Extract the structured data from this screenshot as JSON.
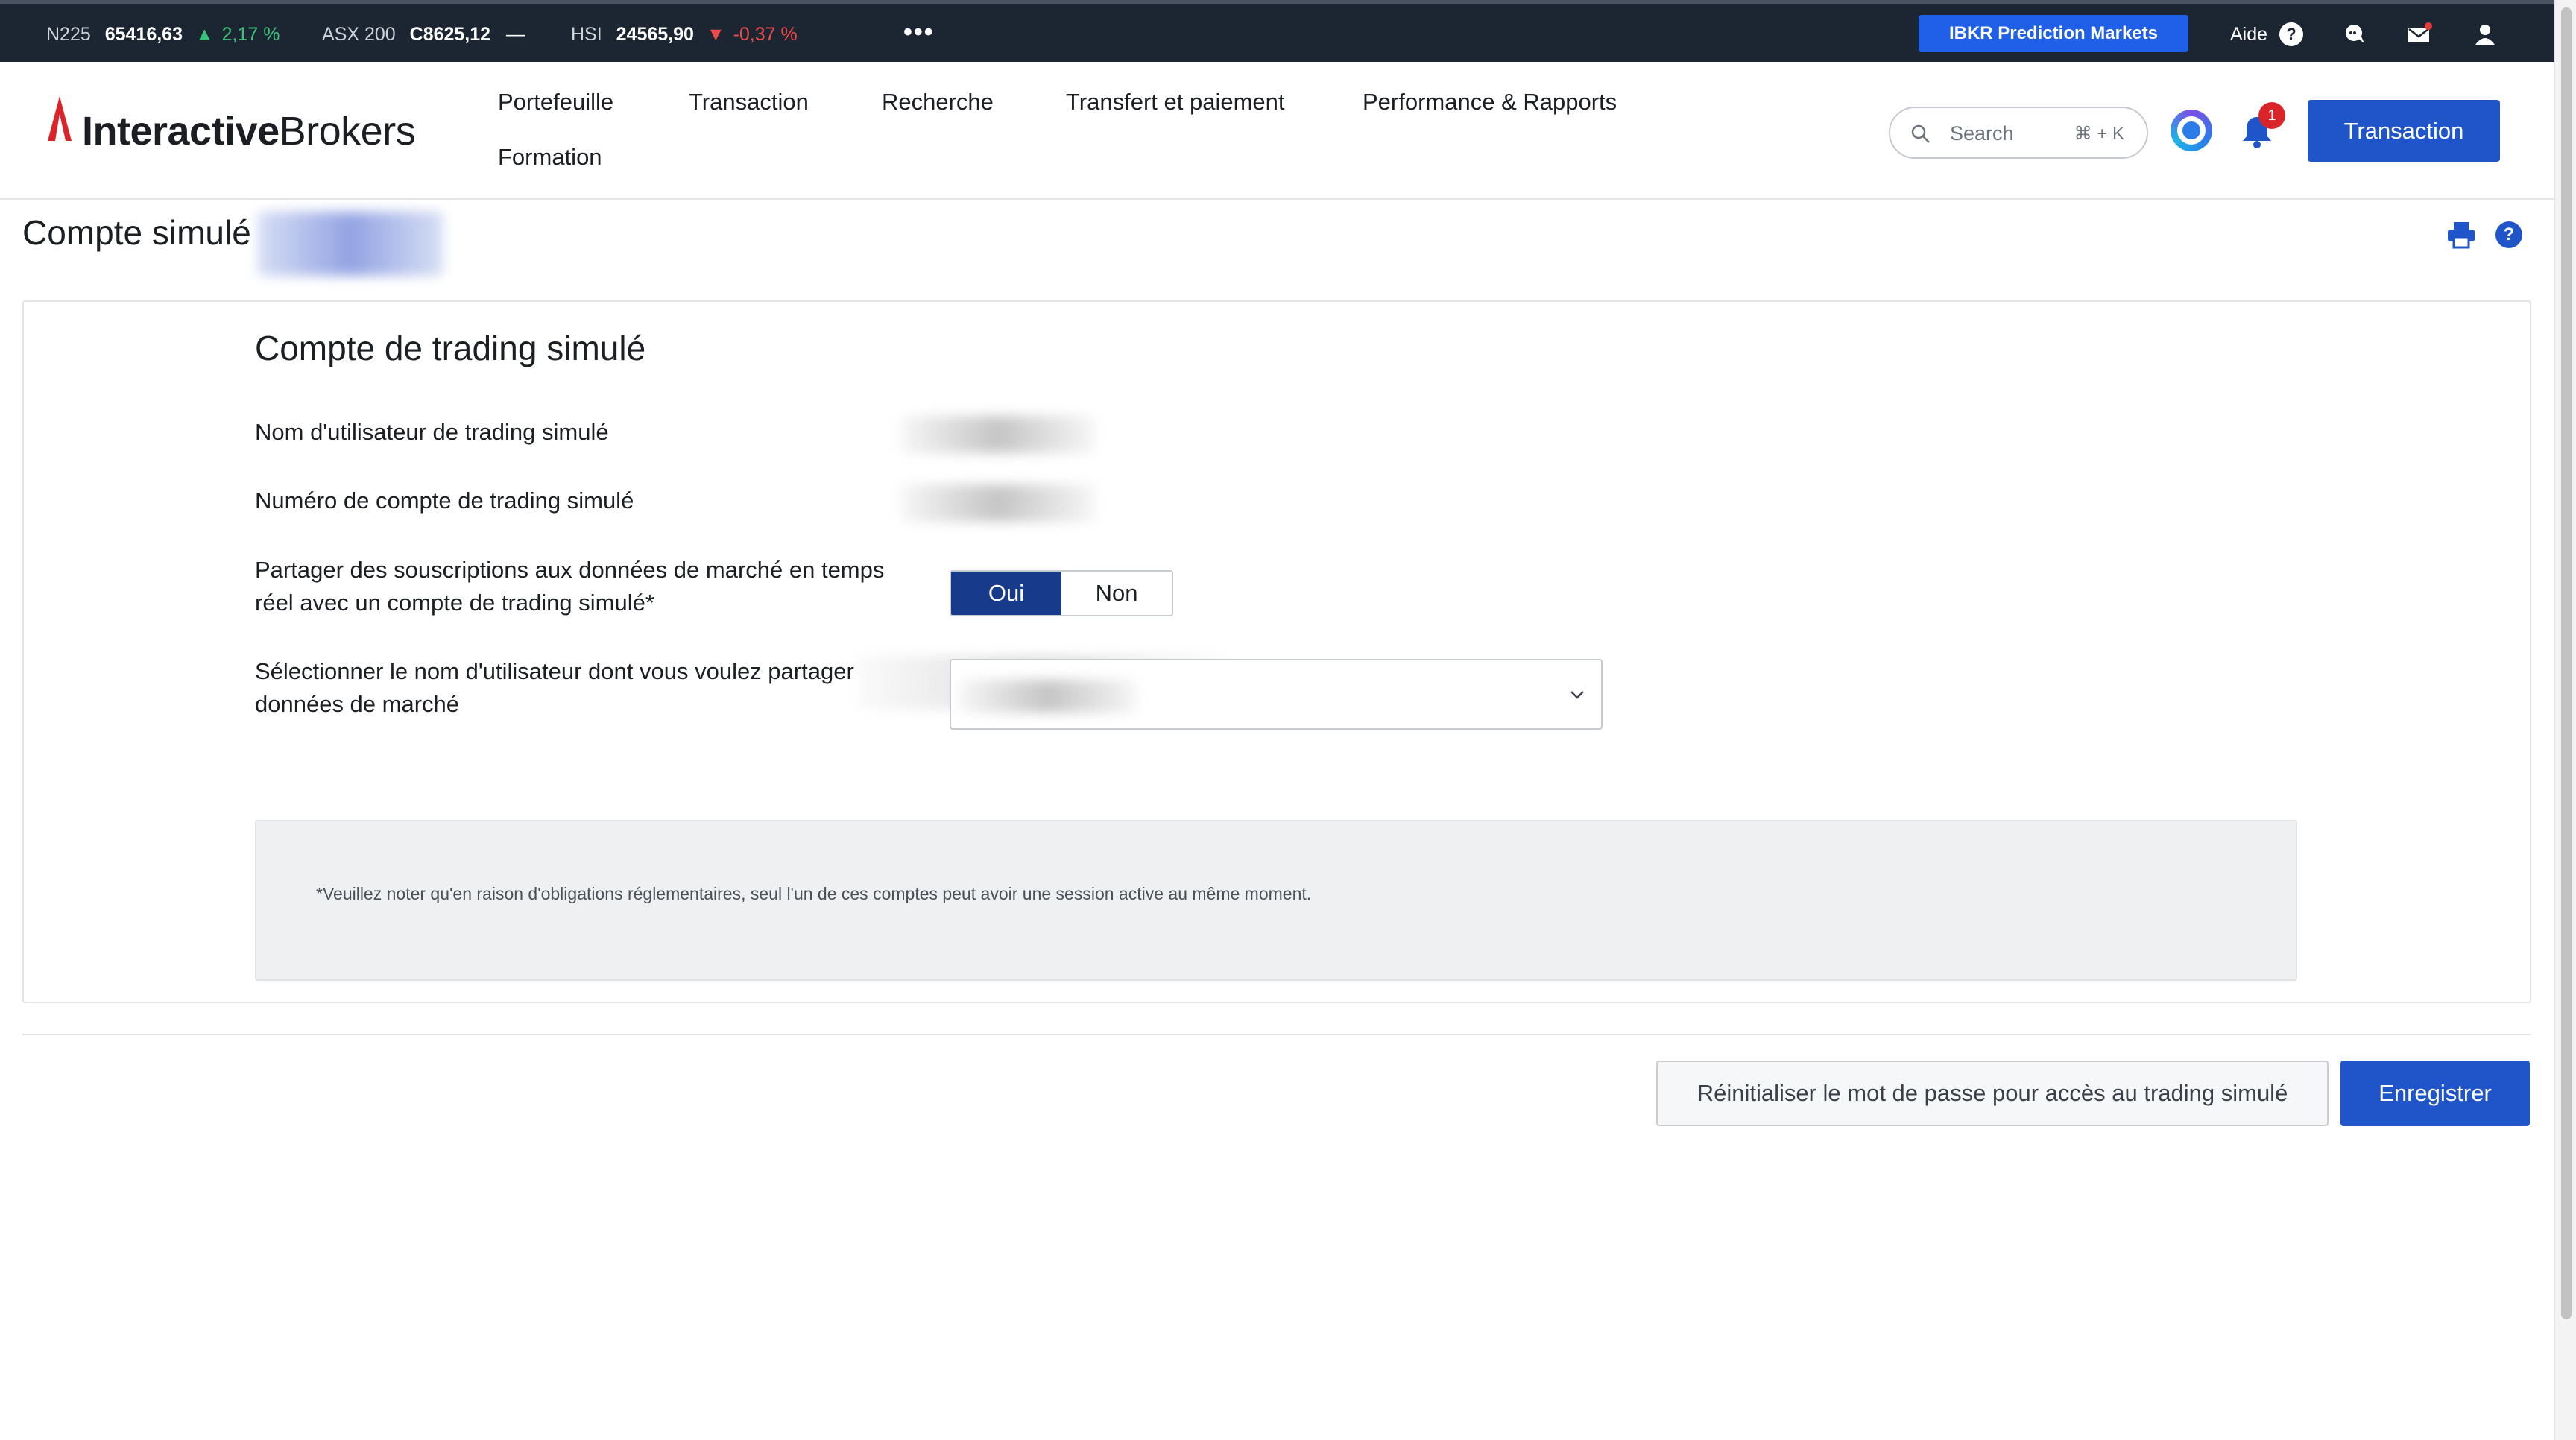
{
  "ticker": {
    "items": [
      {
        "symbol": "N225",
        "value": "65416,63",
        "arrow": "▲",
        "change": "2,17 %",
        "direction": "up"
      },
      {
        "symbol": "ASX 200",
        "value": "C8625,12",
        "arrow": "",
        "change": "—",
        "direction": "flat"
      },
      {
        "symbol": "HSI",
        "value": "24565,90",
        "arrow": "▼",
        "change": "-0,37 %",
        "direction": "down"
      }
    ],
    "more": "•••",
    "prediction_button": "IBKR Prediction Markets",
    "help_label": "Aide",
    "help_icon": "?",
    "icons": [
      "chat-icon",
      "mail-icon",
      "user-icon"
    ]
  },
  "brand": {
    "name_bold": "Interactive",
    "name_regular": "Brokers",
    "accent_color": "#d9252a"
  },
  "nav": {
    "items": [
      "Portefeuille",
      "Transaction",
      "Recherche",
      "Transfert et paiement",
      "Performance & Rapports",
      "Formation"
    ],
    "search_placeholder": "Search",
    "search_shortcut": "⌘ + K",
    "notification_count": "1",
    "trade_button": "Transaction"
  },
  "page": {
    "title": "Compte simulé",
    "help_icon": "?"
  },
  "card": {
    "title": "Compte de trading simulé",
    "rows": [
      {
        "label": "Nom d'utilisateur de trading simulé"
      },
      {
        "label": "Numéro de compte de trading simulé"
      },
      {
        "label": "Partager des souscriptions aux données de marché en temps réel avec un compte de trading simulé*"
      },
      {
        "label": "Sélectionner le nom d'utilisateur dont vous voulez partager données de marché"
      }
    ],
    "toggle": {
      "yes": "Oui",
      "no": "Non",
      "selected": "Oui"
    },
    "note": "*Veuillez noter qu'en raison d'obligations réglementaires, seul l'un de ces comptes peut avoir une session active au même moment."
  },
  "actions": {
    "reset_button": "Réinitialiser le mot de passe pour accès au trading simulé",
    "save_button": "Enregistrer"
  },
  "colors": {
    "ticker_bg": "#1c2633",
    "primary": "#1f55c8",
    "toggle_selected": "#183a8a",
    "positive": "#3ac27a",
    "negative": "#f04a4a"
  }
}
